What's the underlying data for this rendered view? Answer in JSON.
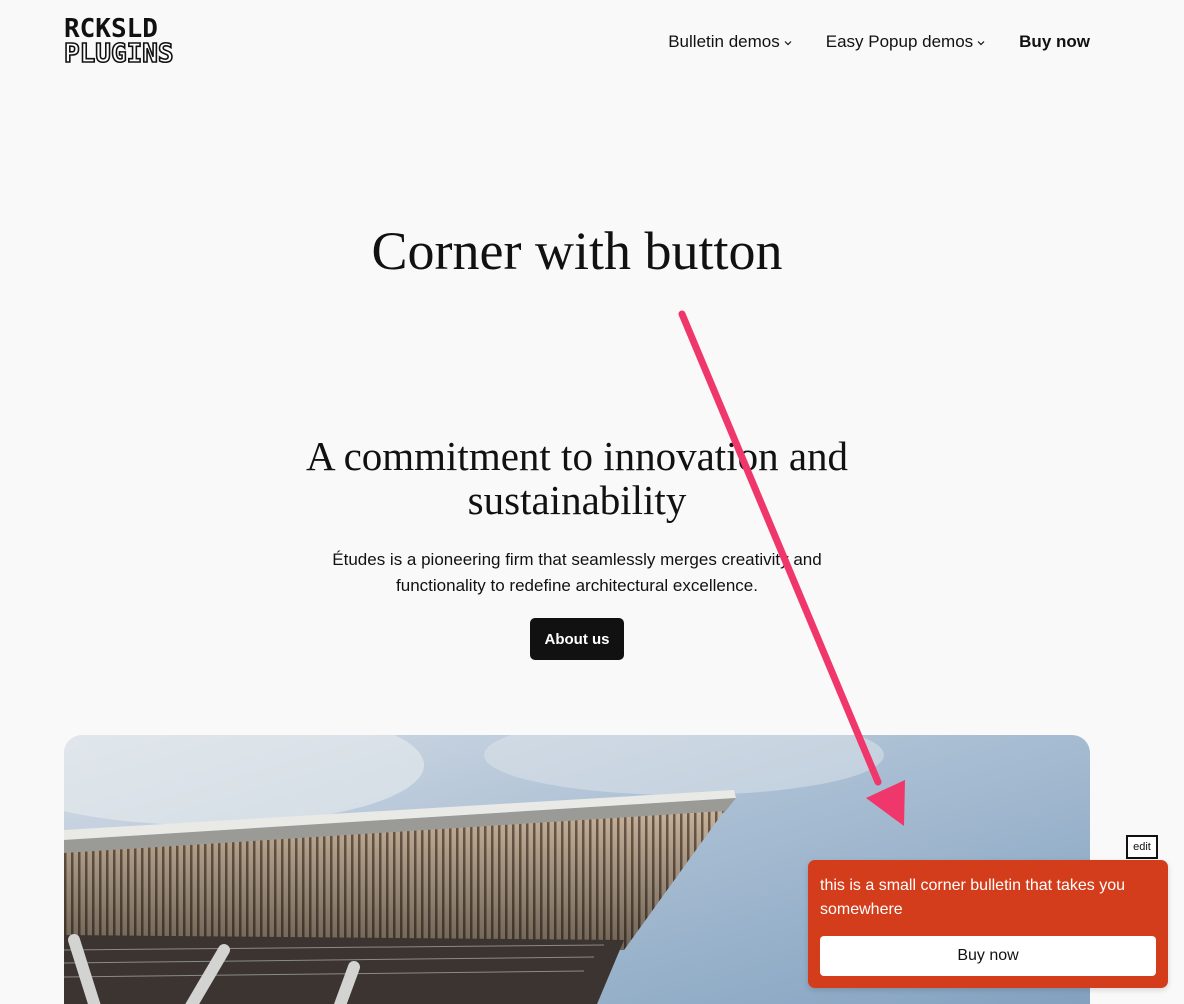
{
  "brand": {
    "logo_top": "RCKSLD",
    "logo_bottom": "PLUGINS"
  },
  "nav": {
    "items": [
      {
        "label": "Bulletin demos",
        "has_dropdown": true
      },
      {
        "label": "Easy Popup demos",
        "has_dropdown": true
      },
      {
        "label": "Buy now",
        "has_dropdown": false
      }
    ]
  },
  "main": {
    "page_title": "Corner with button",
    "heading_line1": "A commitment to innovation and",
    "heading_line2": "sustainability",
    "intro_line1": "Études is a pioneering firm that seamlessly merges creativity and",
    "intro_line2": "functionality to redefine architectural excellence.",
    "about_button": "About us"
  },
  "edit_tag": "edit",
  "bulletin": {
    "text": "this is a small corner bulletin that takes you somewhere",
    "button_label": "Buy now"
  },
  "colors": {
    "background": "#f9f9f9",
    "bulletin": "#d43d1b",
    "arrow": "#f0376b",
    "dark_button": "#111111"
  },
  "icons": {
    "dropdown": "chevron-down-icon",
    "arrow": "pink-annotation-arrow"
  }
}
